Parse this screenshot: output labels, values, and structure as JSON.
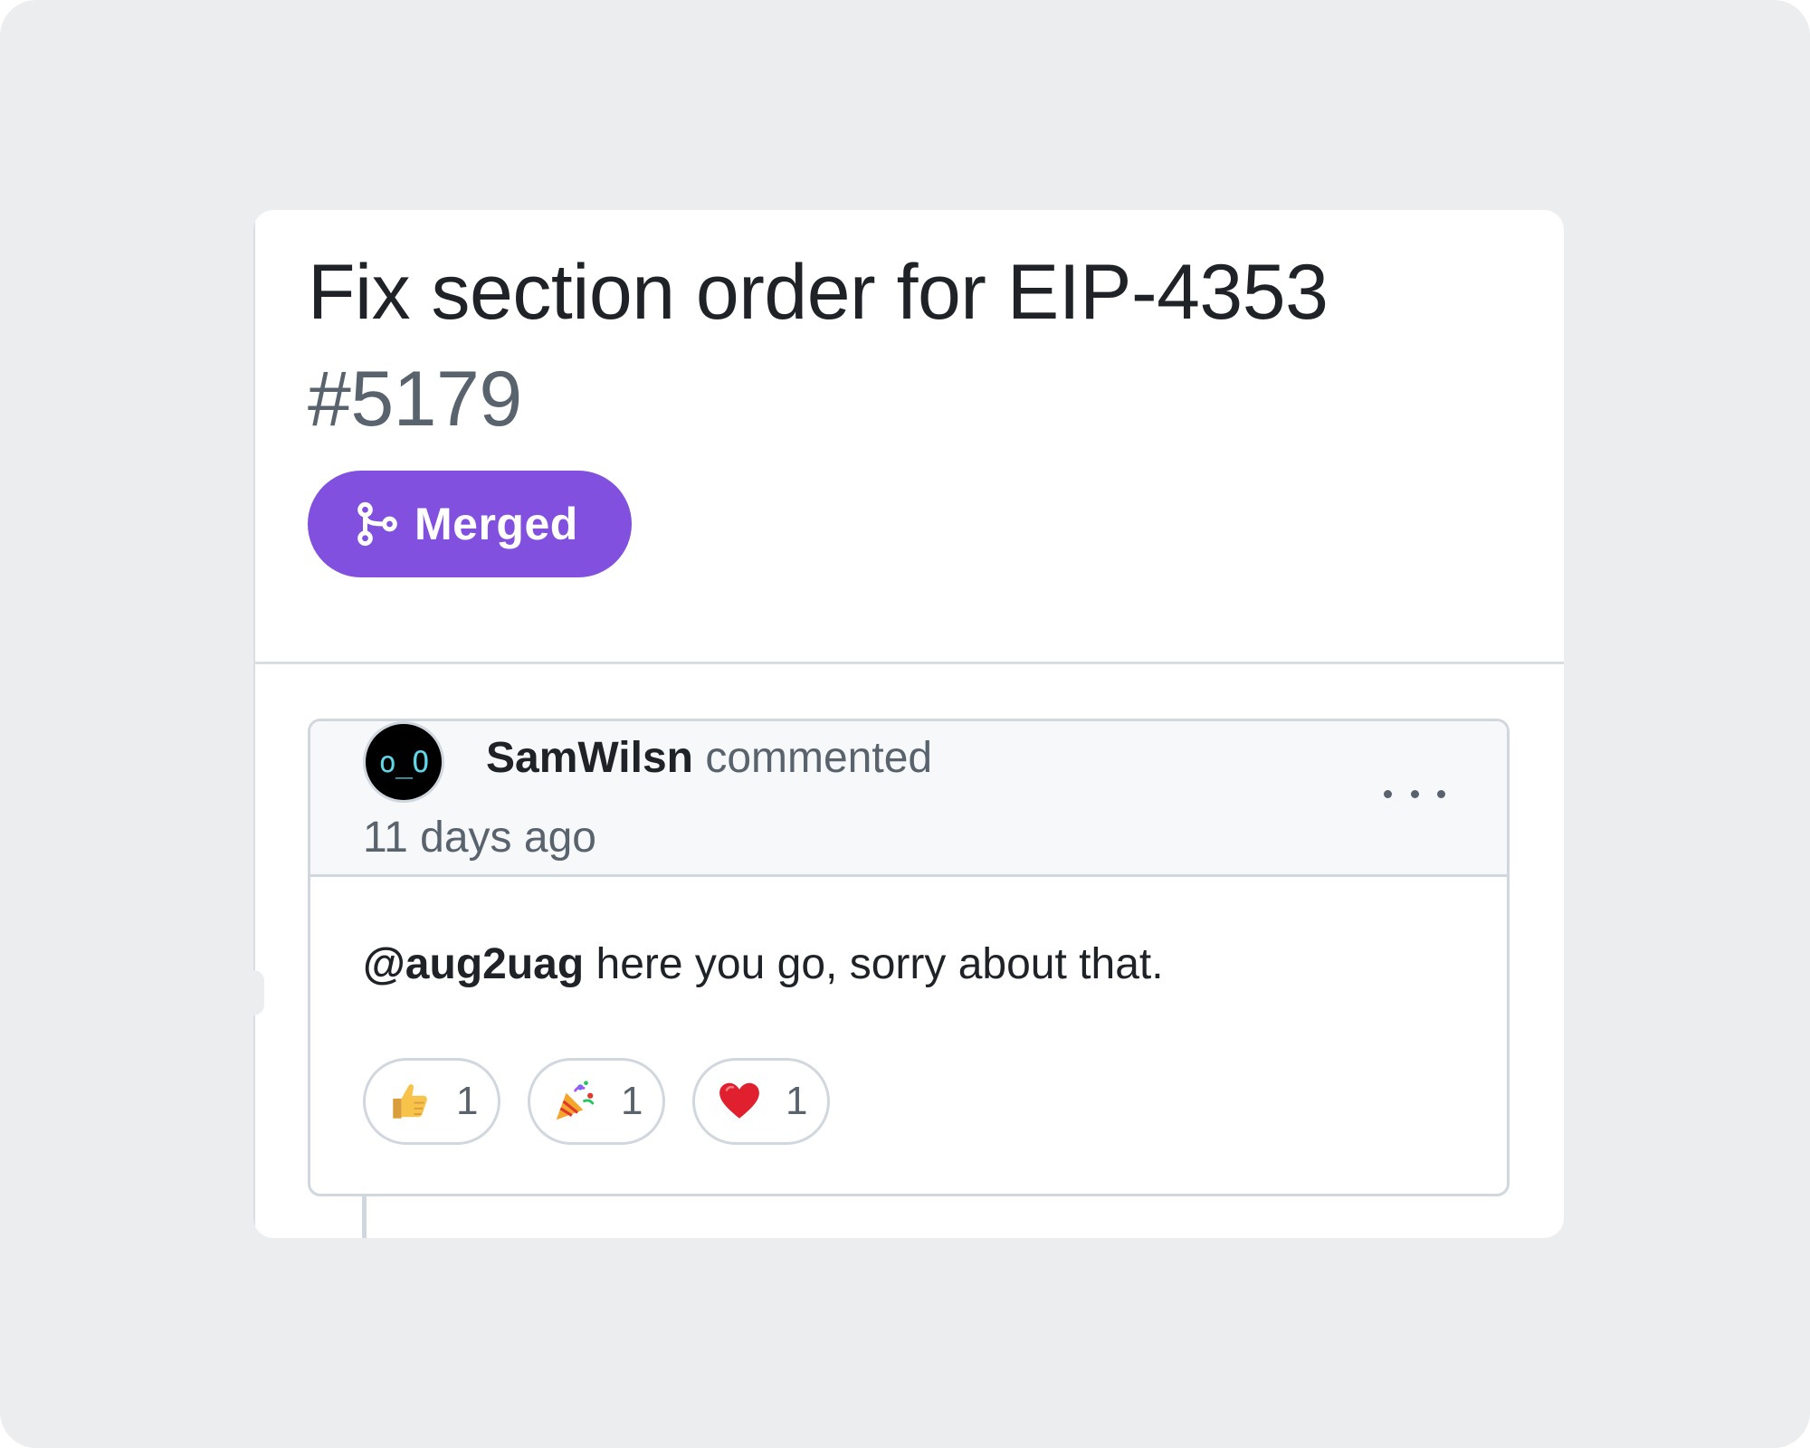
{
  "pull_request": {
    "title": "Fix section order for EIP-4353",
    "number": "#5179",
    "status": "Merged",
    "status_color": "#8250df"
  },
  "comment": {
    "avatar_text": "o_O",
    "author": "SamWilsn",
    "action": "commented",
    "timestamp": "11 days ago",
    "mention": "@aug2uag",
    "body": "here you go, sorry about that.",
    "reactions": [
      {
        "icon": "thumbs-up-icon",
        "count": "1"
      },
      {
        "icon": "party-popper-icon",
        "count": "1"
      },
      {
        "icon": "heart-icon",
        "count": "1"
      }
    ]
  },
  "colors": {
    "text_primary": "#1f2328",
    "text_muted": "#59636e",
    "border": "#d0d7de",
    "header_bg": "#f6f8fa",
    "page_bg": "#ebedef"
  }
}
